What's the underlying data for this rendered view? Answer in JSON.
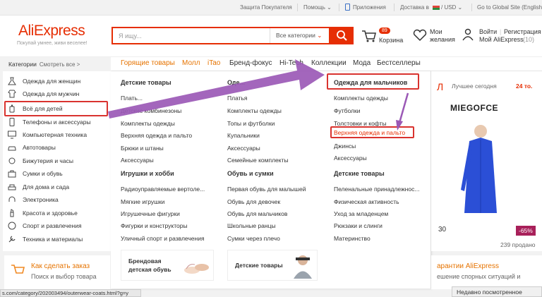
{
  "topbar": {
    "buyer_protection": "Защита Покупателя",
    "help": "Помощь ⌄",
    "apps": "Приложения",
    "delivery": "Доставка в",
    "currency": "/ USD ⌄",
    "global": "Go to Global Site (English)"
  },
  "header": {
    "logo": "AliExpress",
    "slogan": "Покупай умнее, живи веселее!",
    "search_placeholder": "Я ищу...",
    "search_category": "Все категории",
    "cart_count": "89",
    "cart_label": "Корзина",
    "wishlist_1": "Мои",
    "wishlist_2": "желания",
    "login": "Войти",
    "register": "Регистрация",
    "my_ali": "Мой AliExpress",
    "my_ali_count": "(10)"
  },
  "nav": {
    "categories": "Категории",
    "see_all": "Смотреть все >",
    "items": [
      "Горящие товары",
      "Молл",
      "iTao",
      "Бренд-фокус",
      "Hi-Tech",
      "Коллекции",
      "Мода",
      "Бестселлеры"
    ]
  },
  "left_categories": [
    "Одежда для женщин",
    "Одежда для мужчин",
    "Всё для детей",
    "Телефоны и аксессуары",
    "Компьютерная техника",
    "Автотовары",
    "Бижутерия и часы",
    "Сумки и обувь",
    "Для дома и сада",
    "Электроника",
    "Красота и здоровье",
    "Спорт и развлечения",
    "Техника и материалы"
  ],
  "mega": {
    "col1": {
      "h1": "Детские товары",
      "items1": [
        "Плать...",
        "Детские комбинезоны",
        "Комплекты одежды",
        "Верхняя одежда и пальто",
        "Брюки и штаны",
        "Аксессуары"
      ],
      "h2": "Игрушки и хобби",
      "items2": [
        "Радиоуправляемые вертоле...",
        "Мягкие игрушки",
        "Игрушечные фигурки",
        "Фигурки и конструкторы",
        "Уличный спорт и развлечения"
      ],
      "promo_1": "Брендовая",
      "promo_2": "детская обувь"
    },
    "col2": {
      "h1": "Оде...",
      "items1": [
        "Платья",
        "Комплекты одежды",
        "Топы и футболки",
        "Купальники",
        "Аксессуары",
        "Семейные комплекты"
      ],
      "h2": "Обувь и сумки",
      "items2": [
        "Первая обувь для малышей",
        "Обувь для девочек",
        "Обувь для мальчиков",
        "Школьные ранцы",
        "Сумки через плечо"
      ],
      "promo": "Детские товары"
    },
    "col3": {
      "h1": "Одежда для мальчиков",
      "items1": [
        "Комплекты одежды",
        "Футболки",
        "Толстовки и кофты",
        "Верхняя одежда и пальто",
        "Джинсы",
        "Аксессуары"
      ],
      "h2": "Детские товары",
      "items2": [
        "Пеленальные принадлежнос...",
        "Физическая активность",
        "Уход за младенцем",
        "Рюкзаки и слинги",
        "Материнство"
      ]
    }
  },
  "right_panel": {
    "best_today": "Лучшее сегодня",
    "count": "24 то.",
    "brand": "MIEGOFCE",
    "price_tail": "30",
    "discount": "-65%",
    "sold": "239 продано"
  },
  "below": {
    "how_to_order": "Как сделать заказ",
    "search_choose": "Поиск и выбор товара",
    "guarantee": "арантии AliExpress",
    "disputes": "ешение спорных ситуаций и"
  },
  "status_url": "s.com/category/202003494/outerwear-coats.html?g=y",
  "recently_viewed": "Недавно посмотренное",
  "colors": {
    "accent": "#e62e04",
    "highlight": "#d9332f",
    "arrow": "#9b59b6",
    "nav_orange": "#e67300"
  }
}
